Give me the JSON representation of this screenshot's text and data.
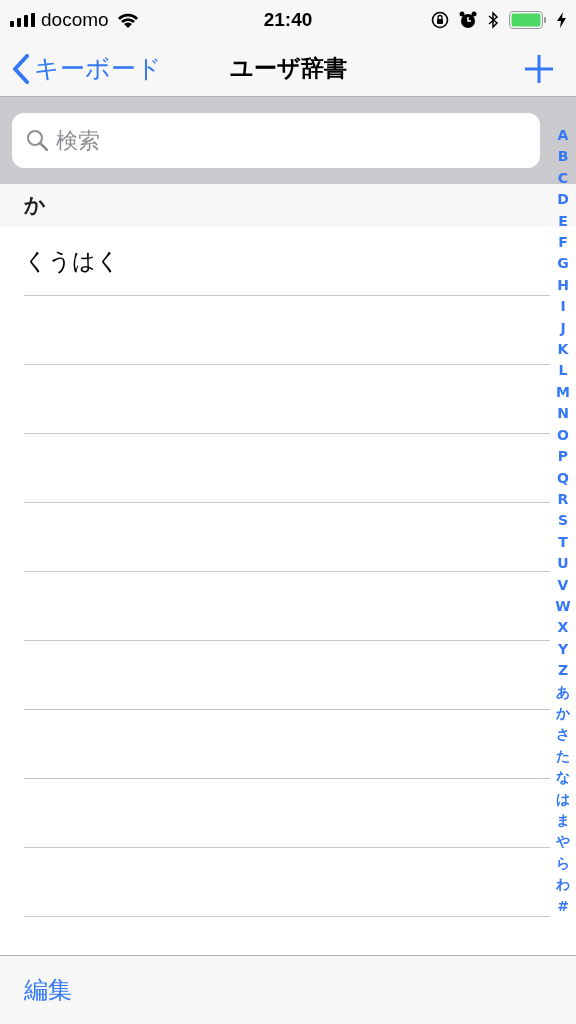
{
  "status_bar": {
    "carrier": "docomo",
    "time": "21:40"
  },
  "nav": {
    "back": "キーボード",
    "title": "ユーザ辞書"
  },
  "search": {
    "placeholder": "検索"
  },
  "sections": [
    {
      "header": "か",
      "rows": [
        "くうはく"
      ]
    }
  ],
  "index": [
    "A",
    "B",
    "C",
    "D",
    "E",
    "F",
    "G",
    "H",
    "I",
    "J",
    "K",
    "L",
    "M",
    "N",
    "O",
    "P",
    "Q",
    "R",
    "S",
    "T",
    "U",
    "V",
    "W",
    "X",
    "Y",
    "Z",
    "あ",
    "か",
    "さ",
    "た",
    "な",
    "は",
    "ま",
    "や",
    "ら",
    "わ",
    "#"
  ],
  "toolbar": {
    "edit": "編集"
  }
}
